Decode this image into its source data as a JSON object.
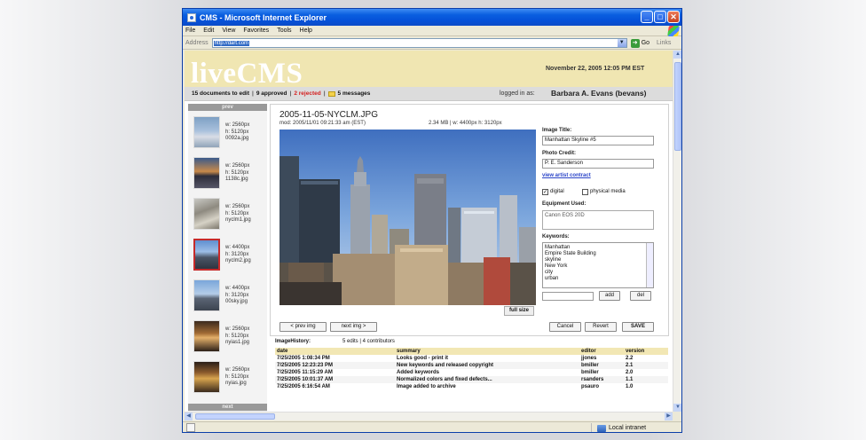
{
  "window": {
    "title": "CMS - Microsoft Internet Explorer",
    "min_glyph": "_",
    "max_glyph": "□",
    "close_glyph": "✕"
  },
  "menu": [
    "File",
    "Edit",
    "View",
    "Favorites",
    "Tools",
    "Help"
  ],
  "address": {
    "label": "Address",
    "url": "http://dart.com",
    "go_label": "Go",
    "links_label": "Links"
  },
  "statusbar": {
    "zone": "Local intranet"
  },
  "cms": {
    "logo": "liveCMS",
    "datetime": "November 22, 2005   12:05 PM EST",
    "status": {
      "docs": "15 documents to edit",
      "approved": "9 approved",
      "rejected": "2 rejected",
      "messages": "5 messages",
      "sep": "|"
    },
    "login_label": "logged in as:",
    "user": "Barbara A. Evans (bevans)"
  },
  "thumbs": {
    "prev_label": "prev",
    "next_label": "next",
    "items": [
      {
        "w": "w: 2560px",
        "h": "h: 5120px",
        "name": "0092a.jpg",
        "selected": false
      },
      {
        "w": "w: 2560px",
        "h": "h: 5120px",
        "name": "1138c.jpg",
        "selected": false
      },
      {
        "w": "w: 2560px",
        "h": "h: 5120px",
        "name": "nyclm1.jpg",
        "selected": false
      },
      {
        "w": "w: 4400px",
        "h": "h: 3120px",
        "name": "nyclm2.jpg",
        "selected": true
      },
      {
        "w": "w: 4400px",
        "h": "h: 3120px",
        "name": "00sky.jpg",
        "selected": false
      },
      {
        "w": "w: 2560px",
        "h": "h: 5120px",
        "name": "nyias1.jpg",
        "selected": false
      },
      {
        "w": "w: 2560px",
        "h": "h: 5120px",
        "name": "nyias.jpg",
        "selected": false
      }
    ]
  },
  "detail": {
    "filename": "2005-11-05-NYCLM.JPG",
    "mod": "mod: 2005/11/01 09:21:33 am (EST)",
    "fileinfo": "2.34 MB  |  w: 4400px  h: 3120px",
    "fullsize_label": "full size",
    "prev_img": "< prev img",
    "next_img": "next img >"
  },
  "form": {
    "title_label": "Image Title:",
    "title_value": "Manhattan Skyline #5",
    "credit_label": "Photo Credit:",
    "credit_value": "P. E. Sanderson",
    "contract_link": "view artist contract",
    "digital_label": "digital",
    "digital_checked": true,
    "physical_label": "physical media",
    "physical_checked": false,
    "equipment_label": "Equipment Used:",
    "equipment_value": "Canon EOS 20D",
    "keywords_label": "Keywords:",
    "keywords": [
      "Manhattan",
      "Empire State Building",
      "skyline",
      "New York",
      "city",
      "urban"
    ],
    "add_label": "add",
    "del_label": "del",
    "cancel_label": "Cancel",
    "revert_label": "Revert",
    "save_label": "SAVE"
  },
  "history": {
    "label": "ImageHistory:",
    "summary": "5 edits  |  4 contributors",
    "columns": [
      "date",
      "summary",
      "editor",
      "version"
    ],
    "rows": [
      [
        "7/25/2005 1:08:34 PM",
        "Looks good - print it",
        "jjones",
        "2.2"
      ],
      [
        "7/25/2005 12:23:23 PM",
        "New keywords and released copyright",
        "bmiller",
        "2.1"
      ],
      [
        "7/25/2005 11:15:29 AM",
        "Added keywords",
        "bmiller",
        "2.0"
      ],
      [
        "7/25/2005 10:01:37 AM",
        "Normalized colors and fixed defects...",
        "rsanders",
        "1.1"
      ],
      [
        "7/25/2005 6:16:54 AM",
        "Image added to archive",
        "psauro",
        "1.0"
      ]
    ]
  }
}
